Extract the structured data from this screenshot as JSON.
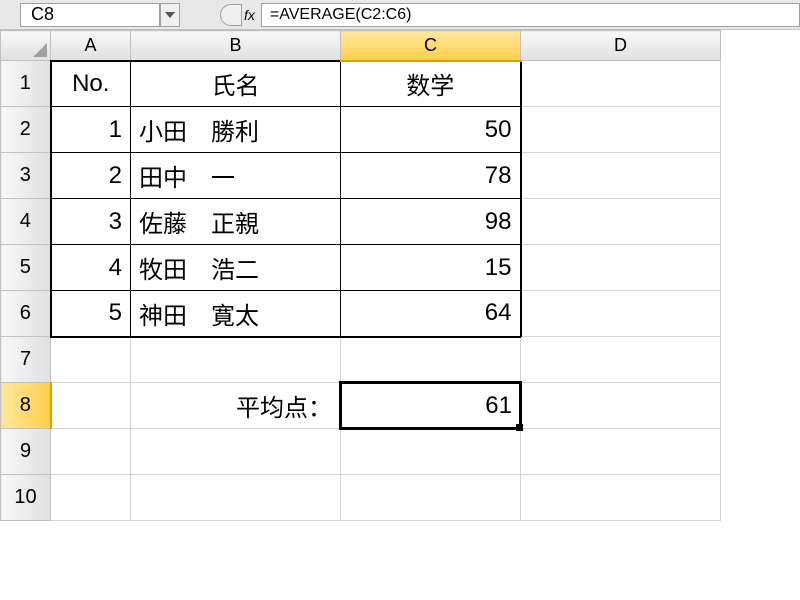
{
  "formula_bar": {
    "name_box": "C8",
    "fx_label": "fx",
    "formula": "=AVERAGE(C2:C6)"
  },
  "columns": [
    "A",
    "B",
    "C",
    "D"
  ],
  "row_numbers": [
    "1",
    "2",
    "3",
    "4",
    "5",
    "6",
    "7",
    "8",
    "9",
    "10"
  ],
  "headers": {
    "no": "No.",
    "name": "氏名",
    "subject": "数学"
  },
  "rows": [
    {
      "no": "1",
      "name": "小田　勝利",
      "score": "50"
    },
    {
      "no": "2",
      "name": "田中　一",
      "score": "78"
    },
    {
      "no": "3",
      "name": "佐藤　正親",
      "score": "98"
    },
    {
      "no": "4",
      "name": "牧田　浩二",
      "score": "15"
    },
    {
      "no": "5",
      "name": "神田　寛太",
      "score": "64"
    }
  ],
  "average": {
    "label": "平均点：",
    "value": "61"
  },
  "active_cell": "C8"
}
